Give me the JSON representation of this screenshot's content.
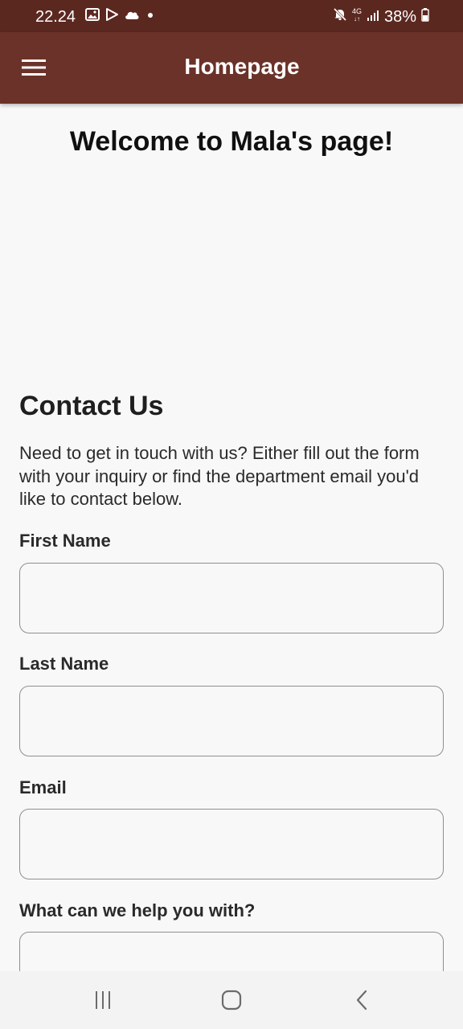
{
  "status_bar": {
    "time": "22.24",
    "network": "4G",
    "battery": "38%",
    "icons": [
      "gallery-icon",
      "play-store-icon",
      "cloud-icon",
      "notification-dot-icon",
      "mute-icon",
      "signal-icon",
      "battery-icon"
    ]
  },
  "app_bar": {
    "title": "Homepage",
    "background": "#6b3229",
    "menu_icon": "hamburger-menu-icon"
  },
  "main": {
    "welcome": "Welcome to Mala's page!",
    "contact_heading": "Contact Us",
    "contact_intro": "Need to get in touch with us? Either fill out the form with your inquiry or find the department email you'd like to contact below."
  },
  "form": {
    "first_name_label": "First Name",
    "first_name_value": "",
    "last_name_label": "Last Name",
    "last_name_value": "",
    "email_label": "Email",
    "email_value": "",
    "help_label": "What can we help you with?",
    "help_value": ""
  },
  "nav_bar": {
    "icons": [
      "recent-apps-icon",
      "home-icon",
      "back-icon"
    ]
  }
}
